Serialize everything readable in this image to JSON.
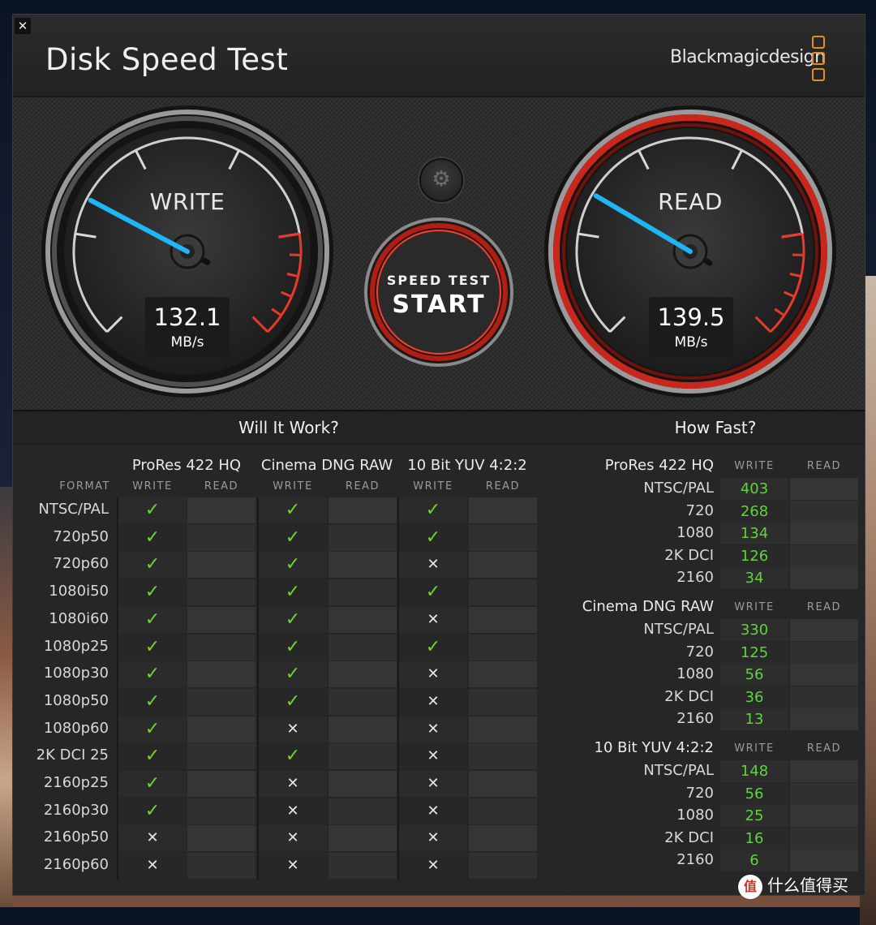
{
  "window": {
    "title": "Disk Speed Test",
    "close_glyph": "✕",
    "brand": "Blackmagicdesign"
  },
  "gauges": {
    "write": {
      "label": "WRITE",
      "value": "132.1",
      "unit": "MB/s",
      "needle_fraction": 0.27
    },
    "read": {
      "label": "READ",
      "value": "139.5",
      "unit": "MB/s",
      "needle_fraction": 0.28
    }
  },
  "controls": {
    "settings_icon": "gear-icon",
    "start_line1": "SPEED TEST",
    "start_line2": "START"
  },
  "colors": {
    "accent_blue": "#1fb6f5",
    "accent_red": "#e8392b",
    "check_green": "#6ed52b",
    "brand_orange": "#e38e1f"
  },
  "will_it_work": {
    "title": "Will It Work?",
    "format_header": "FORMAT",
    "write_label": "WRITE",
    "read_label": "READ",
    "groups": [
      "ProRes 422 HQ",
      "Cinema DNG RAW",
      "10 Bit YUV 4:2:2"
    ],
    "check_glyph": "✓",
    "cross_glyph": "✕",
    "rows": [
      {
        "format": "NTSC/PAL",
        "results": [
          true,
          true,
          true
        ]
      },
      {
        "format": "720p50",
        "results": [
          true,
          true,
          true
        ]
      },
      {
        "format": "720p60",
        "results": [
          true,
          true,
          false
        ]
      },
      {
        "format": "1080i50",
        "results": [
          true,
          true,
          true
        ]
      },
      {
        "format": "1080i60",
        "results": [
          true,
          true,
          false
        ]
      },
      {
        "format": "1080p25",
        "results": [
          true,
          true,
          true
        ]
      },
      {
        "format": "1080p30",
        "results": [
          true,
          true,
          false
        ]
      },
      {
        "format": "1080p50",
        "results": [
          true,
          true,
          false
        ]
      },
      {
        "format": "1080p60",
        "results": [
          true,
          false,
          false
        ]
      },
      {
        "format": "2K DCI 25",
        "results": [
          true,
          true,
          false
        ]
      },
      {
        "format": "2160p25",
        "results": [
          true,
          false,
          false
        ]
      },
      {
        "format": "2160p30",
        "results": [
          true,
          false,
          false
        ]
      },
      {
        "format": "2160p50",
        "results": [
          false,
          false,
          false
        ]
      },
      {
        "format": "2160p60",
        "results": [
          false,
          false,
          false
        ]
      }
    ]
  },
  "how_fast": {
    "title": "How Fast?",
    "write_label": "WRITE",
    "read_label": "READ",
    "groups": [
      {
        "name": "ProRes 422 HQ",
        "rows": [
          {
            "format": "NTSC/PAL",
            "write": "403"
          },
          {
            "format": "720",
            "write": "268"
          },
          {
            "format": "1080",
            "write": "134"
          },
          {
            "format": "2K DCI",
            "write": "126"
          },
          {
            "format": "2160",
            "write": "34"
          }
        ]
      },
      {
        "name": "Cinema DNG RAW",
        "rows": [
          {
            "format": "NTSC/PAL",
            "write": "330"
          },
          {
            "format": "720",
            "write": "125"
          },
          {
            "format": "1080",
            "write": "56"
          },
          {
            "format": "2K DCI",
            "write": "36"
          },
          {
            "format": "2160",
            "write": "13"
          }
        ]
      },
      {
        "name": "10 Bit YUV 4:2:2",
        "rows": [
          {
            "format": "NTSC/PAL",
            "write": "148"
          },
          {
            "format": "720",
            "write": "56"
          },
          {
            "format": "1080",
            "write": "25"
          },
          {
            "format": "2K DCI",
            "write": "16"
          },
          {
            "format": "2160",
            "write": "6"
          }
        ]
      }
    ]
  },
  "watermark": {
    "icon": "值",
    "text": "什么值得买"
  }
}
